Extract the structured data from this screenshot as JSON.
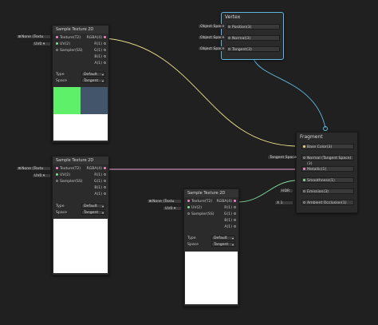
{
  "texture_nodes": [
    {
      "title": "Sample Texture 2D",
      "inputs": [
        {
          "label": "Texture(T2)"
        },
        {
          "label": "UV(2)"
        },
        {
          "label": "Sampler(SS)"
        }
      ],
      "outputs": [
        {
          "label": "RGBA(4)"
        },
        {
          "label": "R(1)"
        },
        {
          "label": "G(1)"
        },
        {
          "label": "B(1)"
        },
        {
          "label": "A(1)"
        }
      ],
      "fields": [
        {
          "label": "Type",
          "value": "Default"
        },
        {
          "label": "Space",
          "value": "Tangent"
        }
      ],
      "texture_chip": "None (Textu",
      "uv_chip": "UV0",
      "preview_colors": [
        "#5ff06a",
        "#42556a"
      ]
    },
    {
      "title": "Sample Texture 2D",
      "inputs": [
        {
          "label": "Texture(T2)"
        },
        {
          "label": "UV(2)"
        },
        {
          "label": "Sampler(SS)"
        }
      ],
      "outputs": [
        {
          "label": "RGBA(4)"
        },
        {
          "label": "R(1)"
        },
        {
          "label": "G(1)"
        },
        {
          "label": "B(1)"
        },
        {
          "label": "A(1)"
        }
      ],
      "fields": [
        {
          "label": "Type",
          "value": "Default"
        },
        {
          "label": "Space",
          "value": "Tangent"
        }
      ],
      "texture_chip": "None (Textu",
      "uv_chip": "UV0"
    },
    {
      "title": "Sample Texture 2D",
      "inputs": [
        {
          "label": "Texture(T2)"
        },
        {
          "label": "UV(2)"
        },
        {
          "label": "Sampler(SS)"
        }
      ],
      "outputs": [
        {
          "label": "RGBA(4)"
        },
        {
          "label": "R(1)"
        },
        {
          "label": "G(1)"
        },
        {
          "label": "B(1)"
        },
        {
          "label": "A(1)"
        }
      ],
      "fields": [
        {
          "label": "Type",
          "value": "Default"
        },
        {
          "label": "Space",
          "value": "Tangent"
        }
      ],
      "texture_chip": "None (Textu",
      "uv_chip": "UV0"
    }
  ],
  "vertex": {
    "title": "Vertex",
    "slots": [
      {
        "label": "Position(3)",
        "chip": "Object Space"
      },
      {
        "label": "Normal(3)",
        "chip": "Object Space"
      },
      {
        "label": "Tangent(3)",
        "chip": "Object Space"
      }
    ]
  },
  "fragment": {
    "title": "Fragment",
    "slots": [
      {
        "label": "Base Color(3)",
        "chip": ""
      },
      {
        "label": "Normal (Tangent Space)(3)",
        "chip": "Tangent Space"
      },
      {
        "label": "Metallic(1)",
        "chip": ""
      },
      {
        "label": "Smoothness(1)",
        "chip": ""
      },
      {
        "label": "Emission(3)",
        "chip": "HDR"
      },
      {
        "label": "Ambient Occlusion(1)",
        "chip": "X  1"
      }
    ]
  },
  "colors": {
    "wire_color": "#e6e08a",
    "wire_vector": "#f0a0d8",
    "wire_float": "#86dca0",
    "wire_vertex": "#5fb7e0",
    "selection": "#5fb7e0"
  }
}
